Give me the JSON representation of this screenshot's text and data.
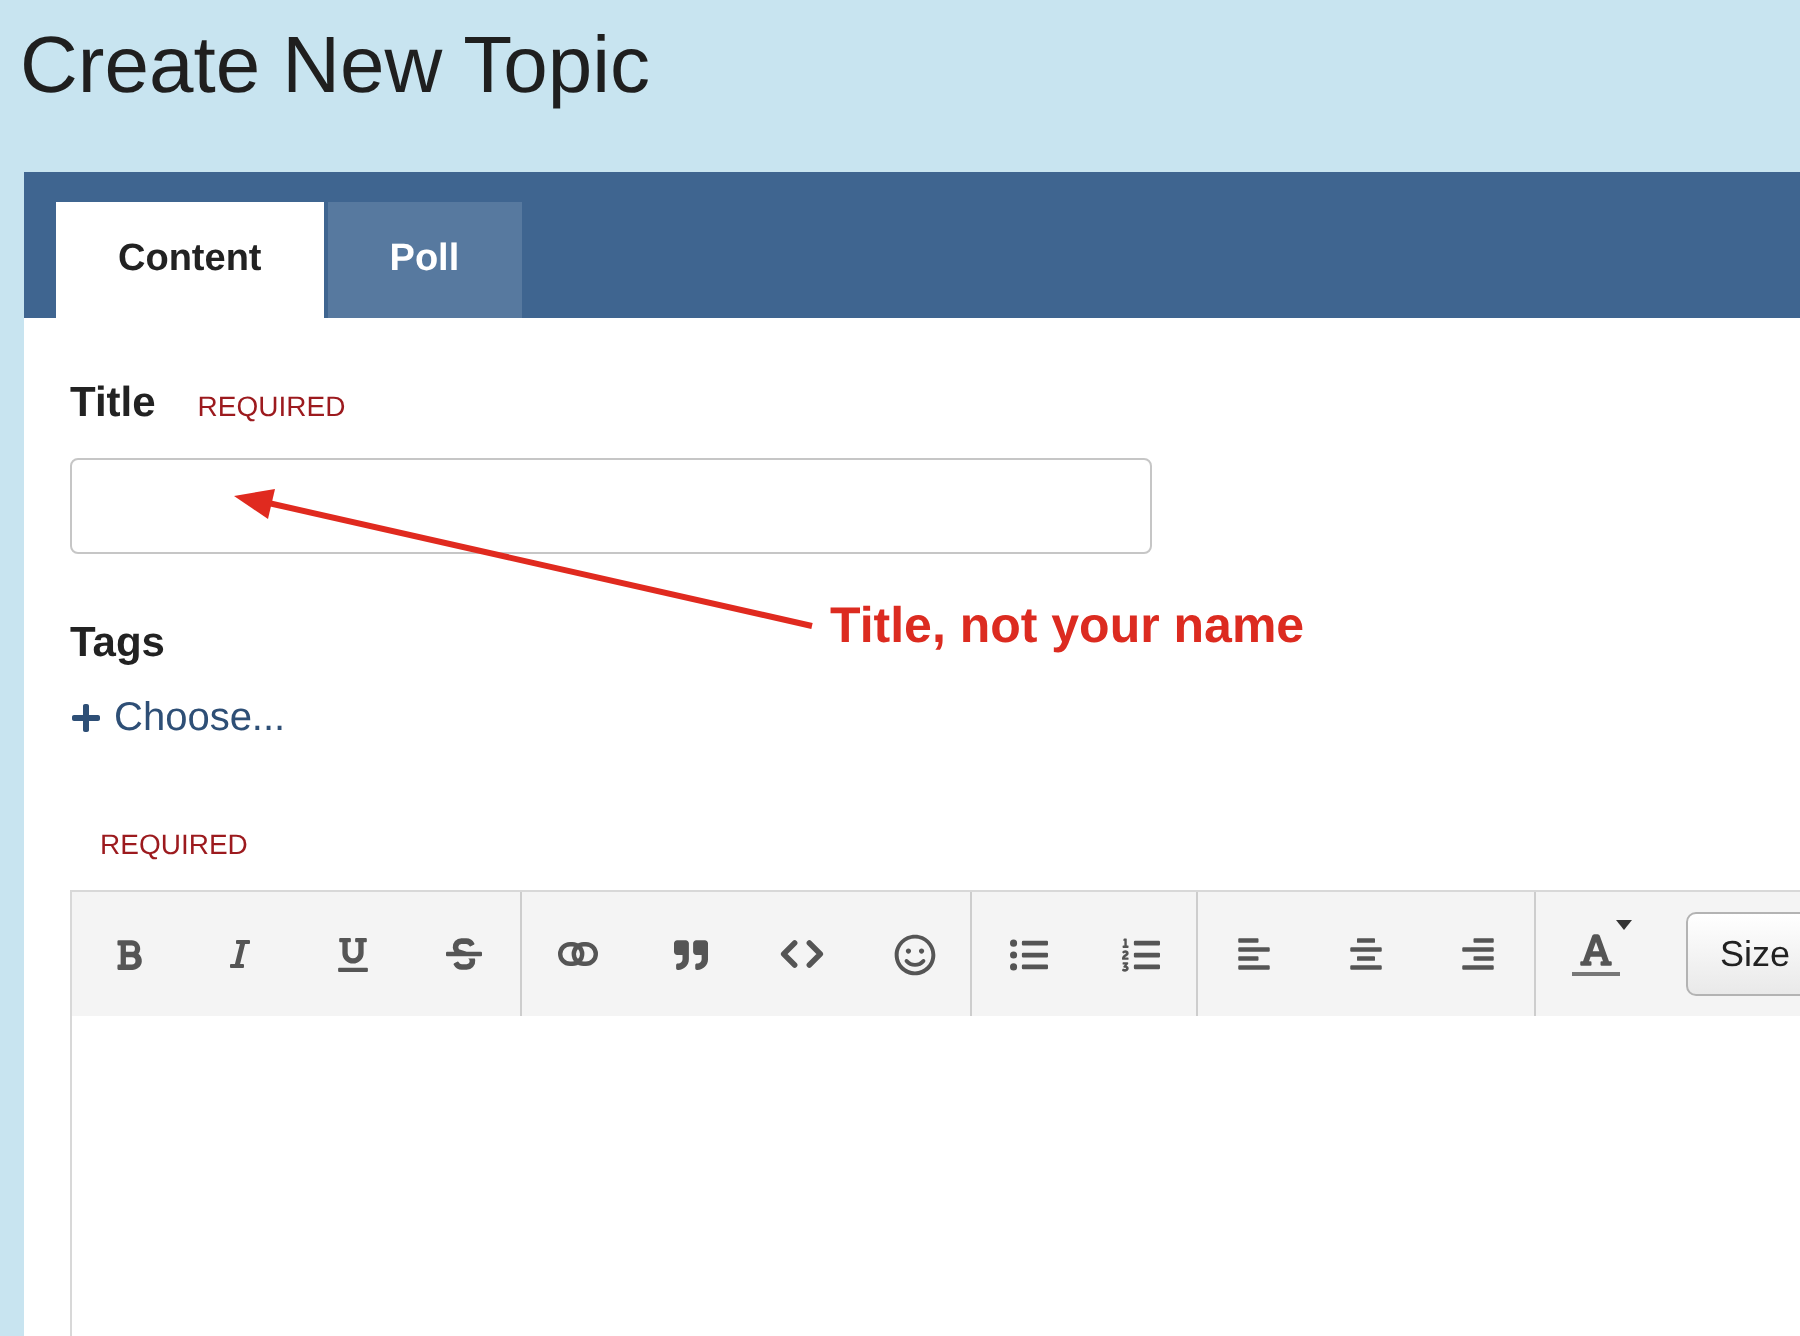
{
  "page_title": "Create New Topic",
  "tabs": [
    {
      "label": "Content",
      "selected": true
    },
    {
      "label": "Poll",
      "selected": false
    }
  ],
  "title_field": {
    "label": "Title",
    "required_note": "REQUIRED"
  },
  "tags": {
    "label": "Tags",
    "choose_link": "Choose..."
  },
  "content_editor": {
    "required_note": "REQUIRED",
    "size_button": "Size"
  },
  "annotation": {
    "text": "Title, not your name"
  }
}
